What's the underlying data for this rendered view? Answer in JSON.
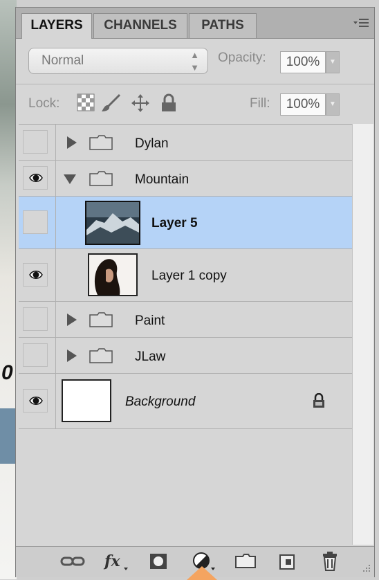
{
  "tabs": [
    {
      "label": "LAYERS",
      "active": true
    },
    {
      "label": "CHANNELS",
      "active": false
    },
    {
      "label": "PATHS",
      "active": false
    }
  ],
  "panel_menu_icon": "panel-menu-icon",
  "blend_mode": {
    "value": "Normal"
  },
  "opacity": {
    "label": "Opacity:",
    "value": "100%"
  },
  "lock": {
    "label": "Lock:",
    "icons": [
      "lock-transparent-icon",
      "lock-image-icon",
      "lock-position-icon",
      "lock-all-icon"
    ]
  },
  "fill": {
    "label": "Fill:",
    "value": "100%"
  },
  "layers": [
    {
      "name": "Dylan",
      "type": "group",
      "expanded": false,
      "visible": false
    },
    {
      "name": "Mountain",
      "type": "group",
      "expanded": true,
      "visible": true
    },
    {
      "name": "Layer 5",
      "type": "layer",
      "selected": true,
      "visible": false,
      "indent": true
    },
    {
      "name": "Layer 1 copy",
      "type": "layer",
      "visible": true,
      "indent": true
    },
    {
      "name": "Paint",
      "type": "group",
      "expanded": false,
      "visible": false
    },
    {
      "name": "JLaw",
      "type": "group",
      "expanded": false,
      "visible": false
    },
    {
      "name": "Background",
      "type": "background",
      "visible": true,
      "locked": true
    }
  ],
  "toolbar": [
    "link-layers-icon",
    "layer-style-fx-icon",
    "add-mask-icon",
    "adjustment-layer-icon",
    "new-group-icon",
    "new-layer-icon",
    "delete-layer-icon"
  ],
  "colors": {
    "selected_row": "#b5d3f7",
    "panel": "#d6d6d6"
  }
}
